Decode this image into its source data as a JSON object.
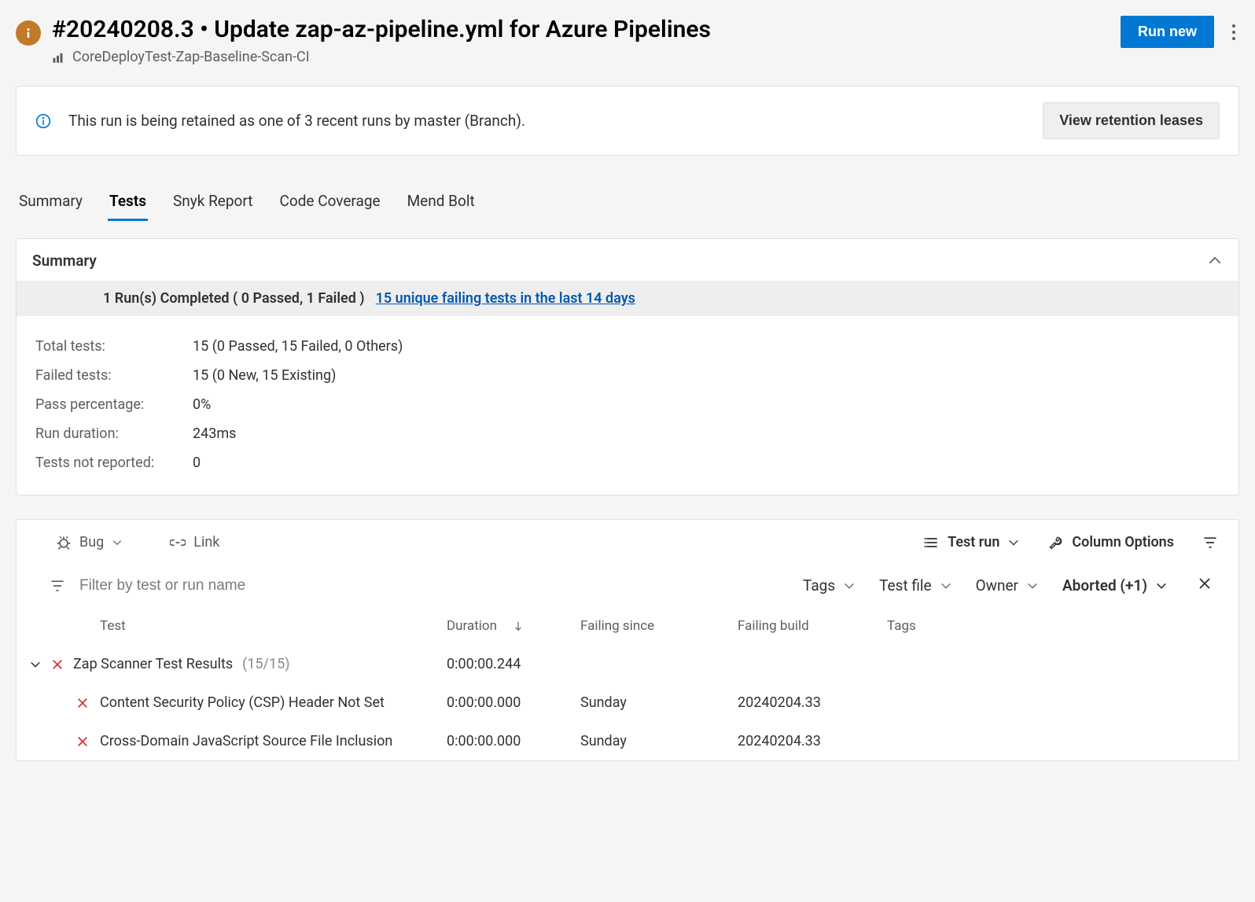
{
  "header": {
    "title": "#20240208.3 • Update zap-az-pipeline.yml for Azure Pipelines",
    "pipeline_name": "CoreDeployTest-Zap-Baseline-Scan-CI",
    "run_new_label": "Run new"
  },
  "banner": {
    "message": "This run is being retained as one of 3 recent runs by master (Branch).",
    "button_label": "View retention leases"
  },
  "tabs": [
    "Summary",
    "Tests",
    "Snyk Report",
    "Code Coverage",
    "Mend Bolt"
  ],
  "active_tab": "Tests",
  "summary_card": {
    "title": "Summary",
    "strip_text": "1 Run(s) Completed ( 0 Passed, 1 Failed )",
    "strip_link": "15 unique failing tests in the last 14 days",
    "rows": [
      {
        "key": "Total tests:",
        "value": "15 (0 Passed, 15 Failed, 0 Others)"
      },
      {
        "key": "Failed tests:",
        "value": "15 (0 New, 15 Existing)"
      },
      {
        "key": "Pass percentage:",
        "value": "0%"
      },
      {
        "key": "Run duration:",
        "value": "243ms"
      },
      {
        "key": "Tests not reported:",
        "value": "0"
      }
    ]
  },
  "toolbar": {
    "bug_label": "Bug",
    "link_label": "Link",
    "test_run_label": "Test run",
    "column_options_label": "Column Options"
  },
  "filter": {
    "placeholder": "Filter by test or run name",
    "tags_label": "Tags",
    "testfile_label": "Test file",
    "owner_label": "Owner",
    "outcome_label": "Aborted (+1)"
  },
  "columns": {
    "test": "Test",
    "duration": "Duration",
    "failing_since": "Failing since",
    "failing_build": "Failing build",
    "tags": "Tags"
  },
  "group": {
    "name": "Zap Scanner Test Results",
    "count": "(15/15)",
    "duration": "0:00:00.244"
  },
  "rows": [
    {
      "name": "Content Security Policy (CSP) Header Not Set",
      "duration": "0:00:00.000",
      "failing_since": "Sunday",
      "failing_build": "20240204.33"
    },
    {
      "name": "Cross-Domain JavaScript Source File Inclusion",
      "duration": "0:00:00.000",
      "failing_since": "Sunday",
      "failing_build": "20240204.33"
    }
  ]
}
